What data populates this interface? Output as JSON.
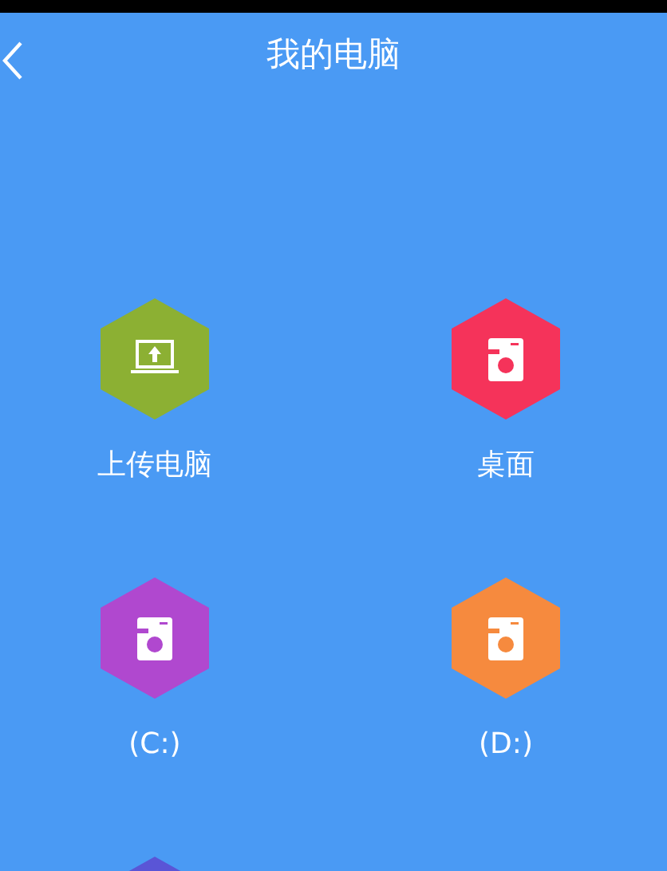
{
  "header": {
    "title": "我的电脑"
  },
  "items": [
    {
      "kind": "laptop",
      "label": "上传电脑",
      "color": "#8cb033"
    },
    {
      "kind": "drive",
      "label": "桌面",
      "color": "#f5335a"
    },
    {
      "kind": "drive",
      "label": "(C:)",
      "color": "#b048cf"
    },
    {
      "kind": "drive",
      "label": "(D:)",
      "color": "#f68a3e"
    },
    {
      "color": "#5a55d6"
    }
  ]
}
